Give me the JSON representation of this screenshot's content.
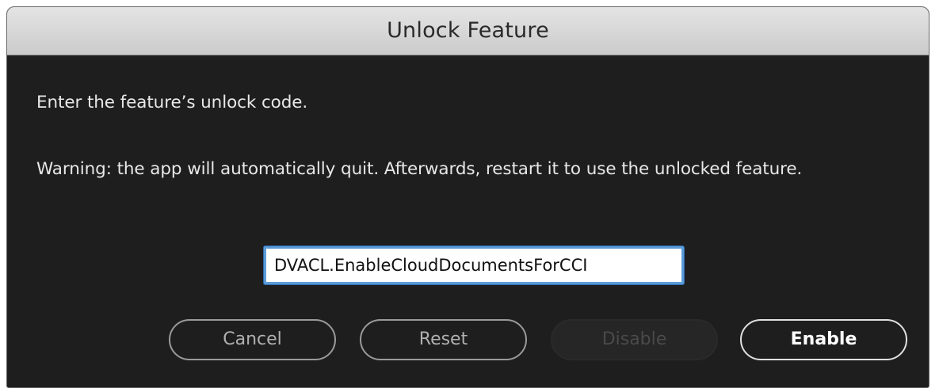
{
  "dialog": {
    "title": "Unlock Feature",
    "instruction": "Enter the feature’s unlock code.",
    "warning": "Warning: the app will automatically quit. Afterwards, restart it to use the unlocked feature.",
    "unlock_code": {
      "value": "DVACL.EnableCloudDocumentsForCCI"
    },
    "buttons": {
      "cancel": "Cancel",
      "reset": "Reset",
      "disable": "Disable",
      "enable": "Enable"
    },
    "disabled_buttons": [
      "Disable"
    ],
    "default_button": "Enable"
  },
  "colors": {
    "dialog_background": "#1e1e1e",
    "titlebar": "#d6d6d6",
    "focus_ring": "#5b9bd8"
  }
}
